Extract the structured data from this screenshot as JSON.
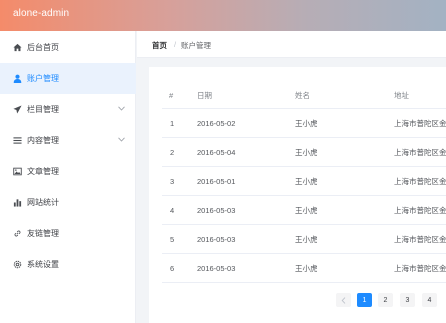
{
  "header": {
    "brand": "alone-admin"
  },
  "sidebar": {
    "items": [
      {
        "label": "后台首页",
        "icon": "home-icon"
      },
      {
        "label": "账户管理",
        "icon": "user-icon",
        "active": true
      },
      {
        "label": "栏目管理",
        "icon": "send-icon",
        "expandable": true
      },
      {
        "label": "内容管理",
        "icon": "list-icon",
        "expandable": true
      },
      {
        "label": "文章管理",
        "icon": "image-icon"
      },
      {
        "label": "网站统计",
        "icon": "bar-chart-icon"
      },
      {
        "label": "友链管理",
        "icon": "link-icon"
      },
      {
        "label": "系统设置",
        "icon": "gear-icon"
      }
    ]
  },
  "breadcrumb": {
    "home": "首页",
    "separator": "/",
    "current": "账户管理"
  },
  "table": {
    "headers": [
      "#",
      "日期",
      "姓名",
      "地址"
    ],
    "rows": [
      {
        "index": "1",
        "date": "2016-05-02",
        "name": "王小虎",
        "address": "上海市普陀区金"
      },
      {
        "index": "2",
        "date": "2016-05-04",
        "name": "王小虎",
        "address": "上海市普陀区金"
      },
      {
        "index": "3",
        "date": "2016-05-01",
        "name": "王小虎",
        "address": "上海市普陀区金"
      },
      {
        "index": "4",
        "date": "2016-05-03",
        "name": "王小虎",
        "address": "上海市普陀区金"
      },
      {
        "index": "5",
        "date": "2016-05-03",
        "name": "王小虎",
        "address": "上海市普陀区金"
      },
      {
        "index": "6",
        "date": "2016-05-03",
        "name": "王小虎",
        "address": "上海市普陀区金"
      }
    ]
  },
  "pagination": {
    "pages": [
      "1",
      "2",
      "3",
      "4"
    ],
    "current": "1",
    "prev_icon": "chevron-left-icon"
  },
  "colors": {
    "accent": "#1e8bff",
    "active_bg": "#eaf2fd"
  }
}
